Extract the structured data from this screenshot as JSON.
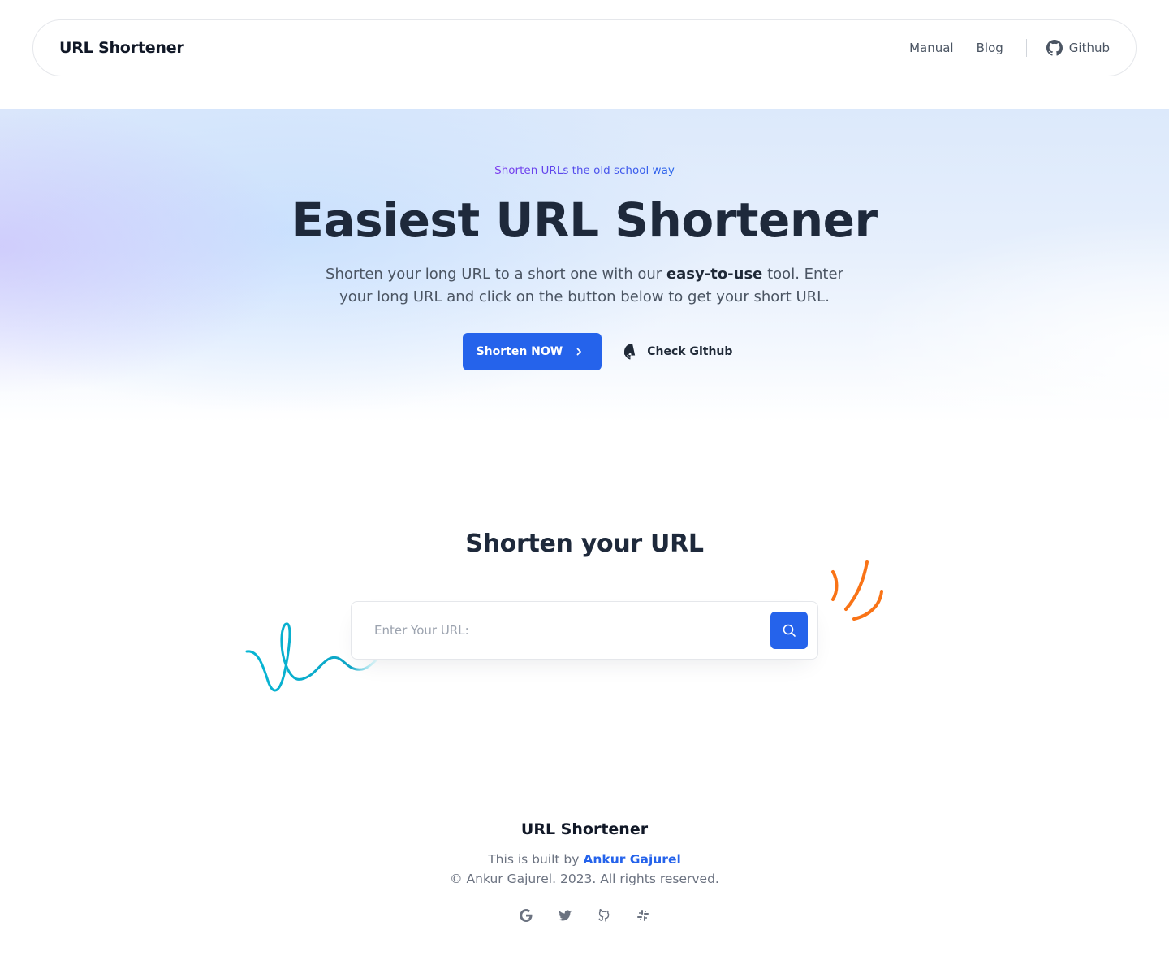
{
  "header": {
    "brand": "URL Shortener",
    "nav": {
      "manual": "Manual",
      "blog": "Blog",
      "github": "Github"
    }
  },
  "hero": {
    "eyebrow": "Shorten URLs the old school way",
    "title": "Easiest URL Shortener",
    "description_before": "Shorten your long URL to a short one with our ",
    "description_bold": "easy-to-use",
    "description_after": " tool. Enter your long URL and click on the button below to get your short URL.",
    "primary_button": "Shorten NOW",
    "secondary_button": "Check Github"
  },
  "shorten": {
    "title": "Shorten your URL",
    "input_placeholder": "Enter Your URL:",
    "input_value": ""
  },
  "footer": {
    "brand": "URL Shortener",
    "built_prefix": "This is built by",
    "author": "Ankur Gajurel",
    "copyright": "© Ankur Gajurel. 2023. All rights reserved.",
    "social_icons": [
      "google-icon",
      "twitter-icon",
      "github-icon",
      "slack-icon"
    ]
  },
  "colors": {
    "accent": "#2563eb",
    "heading": "#1e293b",
    "body_text": "#4b5563",
    "muted_text": "#6b7280",
    "squiggle": "#06b6d4",
    "orange_mark": "#f97316"
  }
}
